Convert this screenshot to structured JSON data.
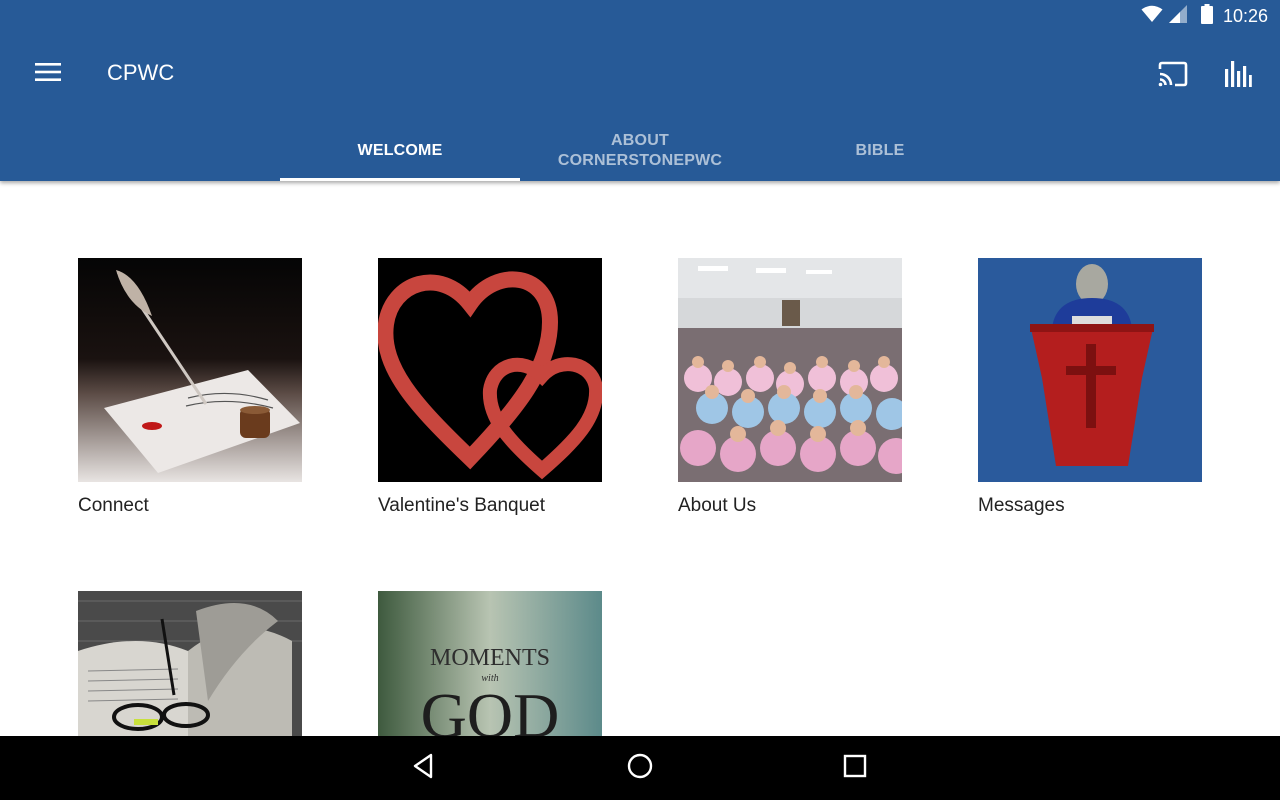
{
  "status_bar": {
    "time": "10:26",
    "icons": [
      "wifi-icon",
      "signal-icon",
      "battery-icon"
    ]
  },
  "toolbar": {
    "title": "CPWC",
    "menu_icon": "hamburger-menu-icon",
    "actions": [
      "cast-icon",
      "stats-icon"
    ]
  },
  "tabs": [
    {
      "label": "WELCOME",
      "active": true
    },
    {
      "label": "ABOUT CORNERSTONEPWC",
      "active": false
    },
    {
      "label": "BIBLE",
      "active": false
    }
  ],
  "tiles": [
    {
      "label": "Connect"
    },
    {
      "label": "Valentine's Banquet"
    },
    {
      "label": "About Us"
    },
    {
      "label": "Messages"
    },
    {
      "label": ""
    },
    {
      "label": "",
      "image_text_1": "MOMENTS",
      "image_text_2": "with",
      "image_text_3": "GOD"
    }
  ],
  "nav_bar": {
    "buttons": [
      "back-icon",
      "home-icon",
      "recents-icon"
    ]
  },
  "colors": {
    "app_bar": "#275a97",
    "tab_indicator": "#ffffff",
    "nav_bar": "#000000"
  }
}
